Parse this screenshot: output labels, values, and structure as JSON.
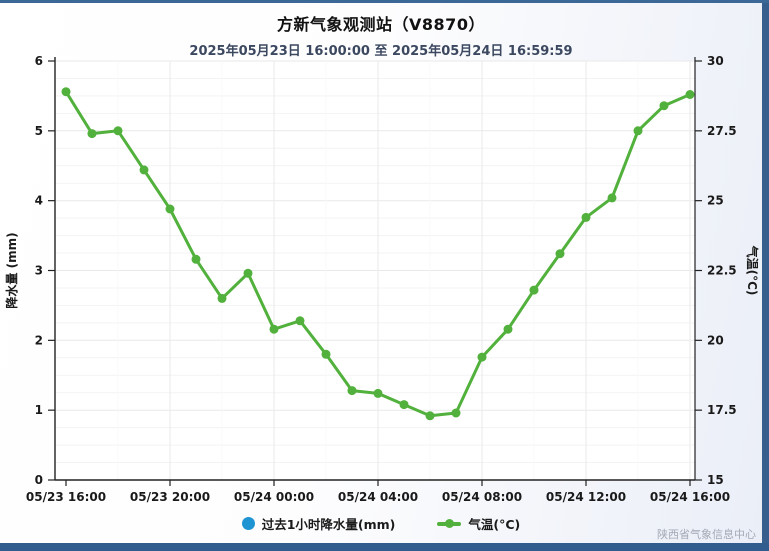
{
  "header": {
    "title": "方新气象观测站（V8870）",
    "subtitle": "2025年05月23日 16:00:00 至 2025年05月24日 16:59:59"
  },
  "frame": {
    "border_color": "#365f8e"
  },
  "watermark": "陕西省气象信息中心",
  "legend": [
    {
      "label": "过去1小时降水量(mm)",
      "marker": "circle",
      "color": "#1e94d2"
    },
    {
      "label": "气温(°C)",
      "marker": "line-dot",
      "color": "#52b13c"
    }
  ],
  "chart_data": {
    "type": "line",
    "title": "方新气象观测站（V8870）",
    "subtitle": "2025年05月23日 16:00:00 至 2025年05月24日 16:59:59",
    "times": [
      "05/23 16:00",
      "05/23 17:00",
      "05/23 18:00",
      "05/23 19:00",
      "05/23 20:00",
      "05/23 21:00",
      "05/23 22:00",
      "05/23 23:00",
      "05/24 00:00",
      "05/24 01:00",
      "05/24 02:00",
      "05/24 03:00",
      "05/24 04:00",
      "05/24 05:00",
      "05/24 06:00",
      "05/24 07:00",
      "05/24 08:00",
      "05/24 09:00",
      "05/24 10:00",
      "05/24 11:00",
      "05/24 12:00",
      "05/24 13:00",
      "05/24 14:00",
      "05/24 15:00",
      "05/24 16:00"
    ],
    "x_tick_labels": [
      "05/23 16:00",
      "05/23 20:00",
      "05/24 00:00",
      "05/24 04:00",
      "05/24 08:00",
      "05/24 12:00",
      "05/24 16:00"
    ],
    "series": [
      {
        "name": "过去1小时降水量(mm)",
        "type": "bar",
        "axis": "left",
        "color": "#1e94d2",
        "values": [
          0,
          0,
          0,
          0,
          0,
          0,
          0,
          0,
          0,
          0,
          0,
          0,
          0,
          0,
          0,
          0,
          0,
          0,
          0,
          0,
          0,
          0,
          0,
          0,
          0
        ]
      },
      {
        "name": "气温(°C)",
        "type": "line",
        "axis": "right",
        "color": "#52b13c",
        "values": [
          28.9,
          27.4,
          27.5,
          26.1,
          24.7,
          22.9,
          21.5,
          22.4,
          20.4,
          20.7,
          19.5,
          18.2,
          18.1,
          17.7,
          17.3,
          17.4,
          19.4,
          20.4,
          21.8,
          23.1,
          24.4,
          25.1,
          27.5,
          28.4,
          28.8
        ]
      }
    ],
    "left_axis": {
      "label": "降水量 (mm)",
      "min": 0,
      "max": 6,
      "step": 1,
      "ticks": [
        0,
        1,
        2,
        3,
        4,
        5,
        6
      ]
    },
    "right_axis": {
      "label": "气温(°C)",
      "min": 15,
      "max": 30,
      "step": 2.5,
      "ticks": [
        15,
        17.5,
        20,
        22.5,
        25,
        27.5,
        30
      ]
    },
    "grid": {
      "on": true,
      "major_color": "#e9e9e9",
      "minor_color": "#f3f3f3",
      "faint_color": "#f8f8f8"
    },
    "axis_color": "#222222",
    "legend_position": "bottom"
  }
}
